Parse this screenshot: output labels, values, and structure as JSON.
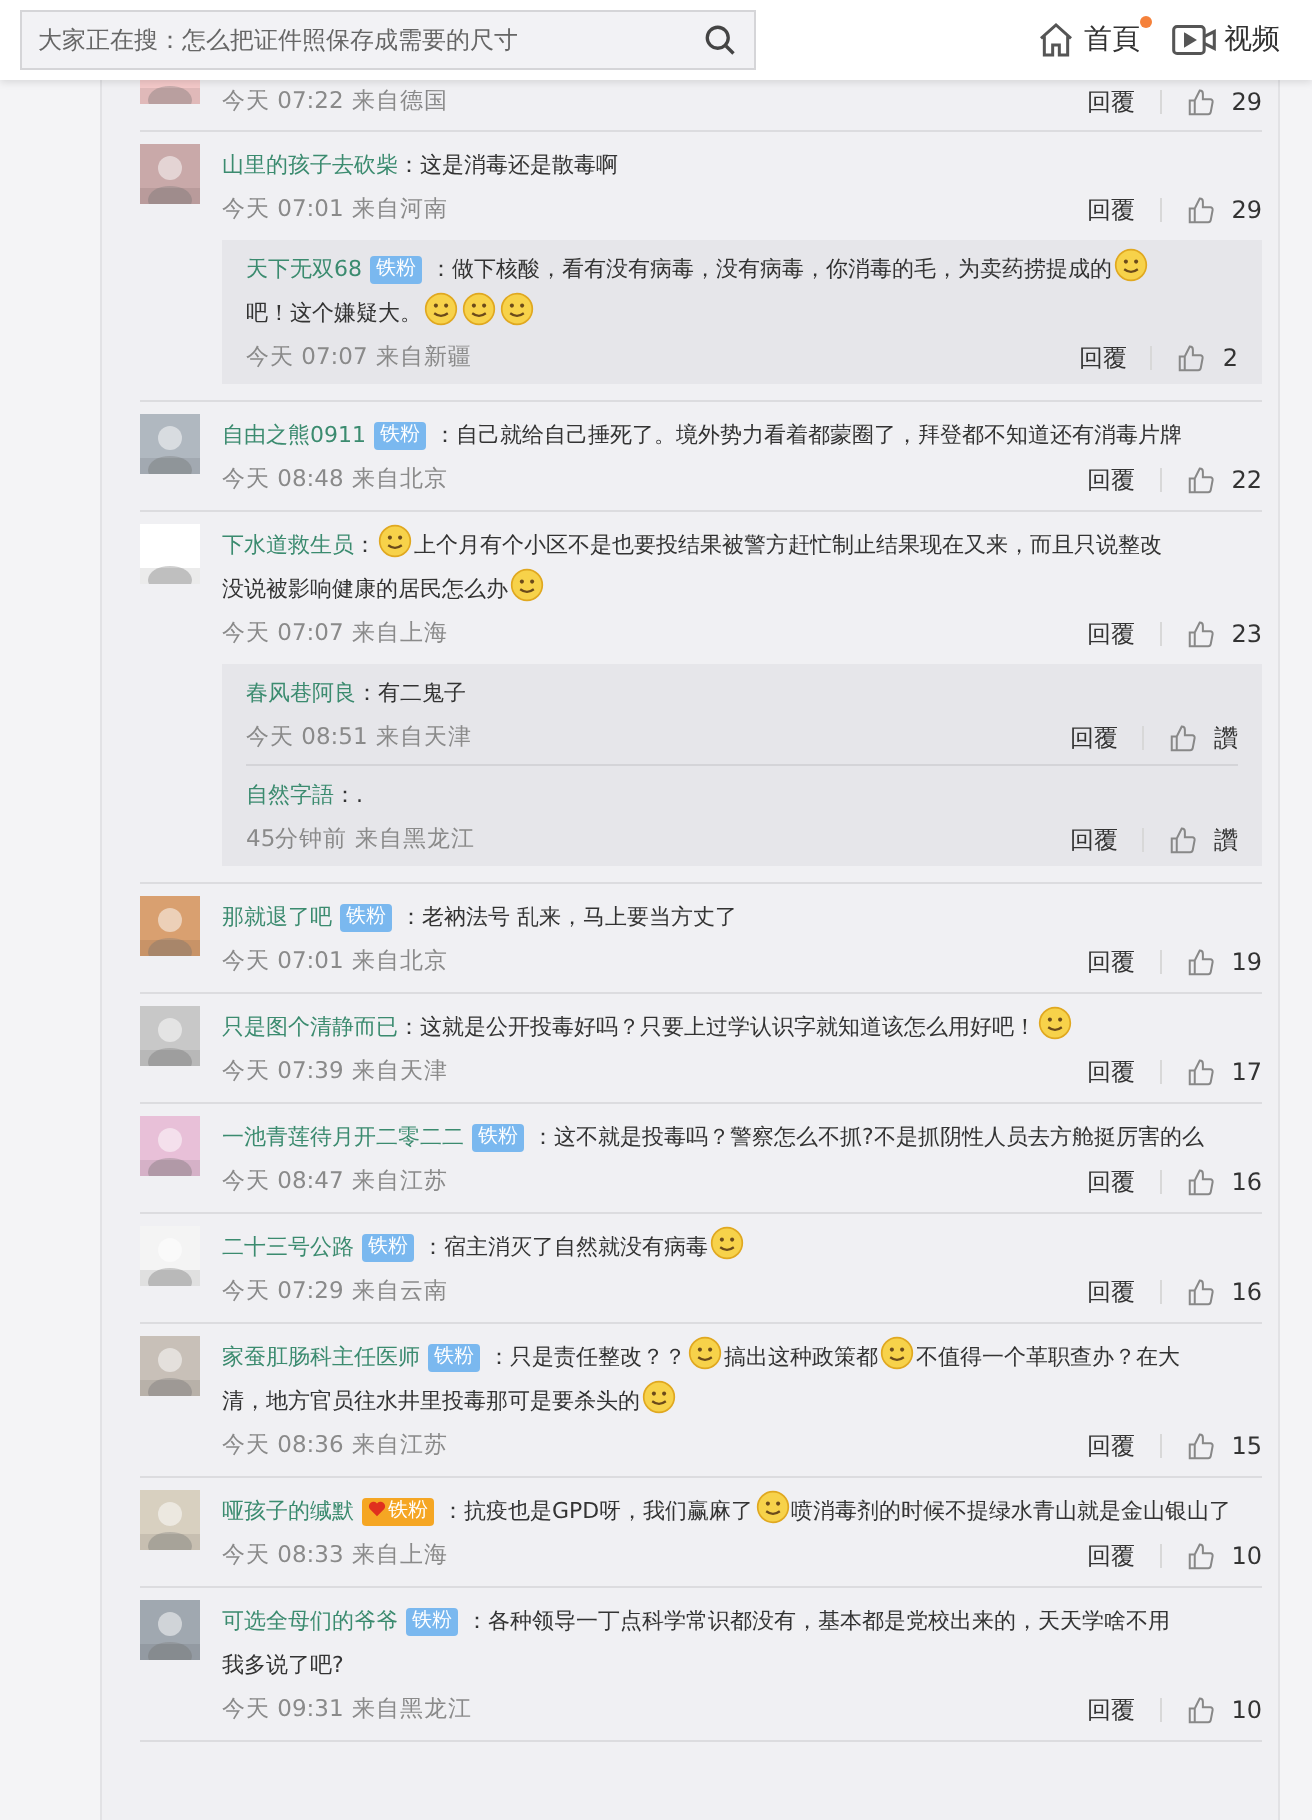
{
  "header": {
    "search": {
      "placeholder": "大家正在搜：怎么把证件照保存成需要的尺寸"
    },
    "nav": [
      {
        "label": "首頁",
        "kind": "home",
        "dot": true
      },
      {
        "label": "视频",
        "kind": "video",
        "dot": false
      }
    ]
  },
  "comments": [
    {
      "partial": true,
      "time": "今天 07:22",
      "location": "来自德国",
      "reply": "回覆",
      "likes": "29"
    },
    {
      "name": "山里的孩子去砍柴",
      "content": [
        {
          "kind": "text",
          "text": "：这是消毒还是散毒啊"
        }
      ],
      "time": "今天 07:01",
      "location": "来自河南",
      "reply": "回覆",
      "likes": "29",
      "replies": [
        {
          "name": "天下无双68",
          "badge": {
            "kind": "fan",
            "label": "铁粉"
          },
          "content": [
            {
              "kind": "text",
              "text": "：做下核酸，看有没有病毒，没有病毒，你消毒的毛，为卖药捞提成的"
            },
            {
              "kind": "emoji"
            },
            {
              "kind": "text",
              "text": "吧！这个嫌疑大。"
            },
            {
              "kind": "emoji"
            },
            {
              "kind": "emoji"
            },
            {
              "kind": "emoji"
            }
          ],
          "time": "今天 07:07",
          "location": "来自新疆",
          "reply": "回覆",
          "likes": "2"
        }
      ]
    },
    {
      "name": "自由之熊0911",
      "badge": {
        "kind": "fan",
        "label": "铁粉"
      },
      "content": [
        {
          "kind": "text",
          "text": "：自己就给自己捶死了。境外势力看着都蒙圈了，拜登都不知道还有消毒片牌"
        }
      ],
      "time": "今天 08:48",
      "location": "来自北京",
      "reply": "回覆",
      "likes": "22"
    },
    {
      "name": "下水道救生员",
      "content": [
        {
          "kind": "text",
          "text": "："
        },
        {
          "kind": "emoji"
        },
        {
          "kind": "text",
          "text": "上个月有个小区不是也要投结果被警方赶忙制止结果现在又来，而且只说整改"
        },
        {
          "kind": "text",
          "text": "没说被影响健康的居民怎么办"
        },
        {
          "kind": "emoji"
        }
      ],
      "time": "今天 07:07",
      "location": "来自上海",
      "reply": "回覆",
      "likes": "23",
      "replies": [
        {
          "name": "春风巷阿良",
          "content": [
            {
              "kind": "text",
              "text": "：有二鬼子"
            }
          ],
          "time": "今天 08:51",
          "location": "来自天津",
          "reply": "回覆",
          "likes": "讚"
        },
        {
          "name": "自然字語",
          "content": [
            {
              "kind": "text",
              "text": "：."
            }
          ],
          "time": "45分钟前",
          "location": "来自黑龙江",
          "reply": "回覆",
          "likes": "讚"
        }
      ]
    },
    {
      "name": "那就退了吧",
      "badge": {
        "kind": "fan",
        "label": "铁粉"
      },
      "content": [
        {
          "kind": "text",
          "text": "：老衲法号 乱来，马上要当方丈了"
        }
      ],
      "time": "今天 07:01",
      "location": "来自北京",
      "reply": "回覆",
      "likes": "19"
    },
    {
      "name": "只是图个清静而已",
      "content": [
        {
          "kind": "text",
          "text": "：这就是公开投毒好吗？只要上过学认识字就知道该怎么用好吧！"
        },
        {
          "kind": "emoji"
        }
      ],
      "time": "今天 07:39",
      "location": "来自天津",
      "reply": "回覆",
      "likes": "17"
    },
    {
      "name": "一池青莲待月开二零二二",
      "badge": {
        "kind": "fan",
        "label": "铁粉"
      },
      "content": [
        {
          "kind": "text",
          "text": "：这不就是投毒吗？警察怎么不抓?不是抓阴性人员去方舱挺厉害的"
        },
        {
          "kind": "text",
          "text": "么"
        }
      ],
      "time": "今天 08:47",
      "location": "来自江苏",
      "reply": "回覆",
      "likes": "16"
    },
    {
      "name": "二十三号公路",
      "badge": {
        "kind": "fan",
        "label": "铁粉"
      },
      "content": [
        {
          "kind": "text",
          "text": "：宿主消灭了自然就没有病毒"
        },
        {
          "kind": "emoji"
        }
      ],
      "time": "今天 07:29",
      "location": "来自云南",
      "reply": "回覆",
      "likes": "16"
    },
    {
      "name": "家蚕肛肠科主任医师",
      "badge": {
        "kind": "fan",
        "label": "铁粉"
      },
      "content": [
        {
          "kind": "text",
          "text": "：只是责任整改？？"
        },
        {
          "kind": "emoji"
        },
        {
          "kind": "text",
          "text": "搞出这种政策都"
        },
        {
          "kind": "emoji"
        },
        {
          "kind": "text",
          "text": "不值得一个革职查办？在大"
        },
        {
          "kind": "text",
          "text": "清，地方官员往水井里投毒那可是要杀头的"
        },
        {
          "kind": "emoji"
        }
      ],
      "time": "今天 08:36",
      "location": "来自江苏",
      "reply": "回覆",
      "likes": "15"
    },
    {
      "name": "哑孩子的缄默",
      "badge": {
        "kind": "gold",
        "label": "铁粉"
      },
      "content": [
        {
          "kind": "text",
          "text": "：抗疫也是GPD呀，我们赢麻了"
        },
        {
          "kind": "emoji"
        },
        {
          "kind": "text",
          "text": "喷消毒剂的时候不提绿水青山就是金山银"
        },
        {
          "kind": "text",
          "text": "山了"
        }
      ],
      "time": "今天 08:33",
      "location": "来自上海",
      "reply": "回覆",
      "likes": "10"
    },
    {
      "name": "可选全母们的爷爷",
      "badge": {
        "kind": "fan",
        "label": "铁粉"
      },
      "content": [
        {
          "kind": "text",
          "text": "：各种领导一丁点科学常识都没有，基本都是党校出来的，天天学啥不用"
        },
        {
          "kind": "text",
          "text": "我多说了吧?"
        }
      ],
      "time": "今天 09:31",
      "location": "来自黑龙江",
      "reply": "回覆",
      "likes": "10"
    }
  ]
}
